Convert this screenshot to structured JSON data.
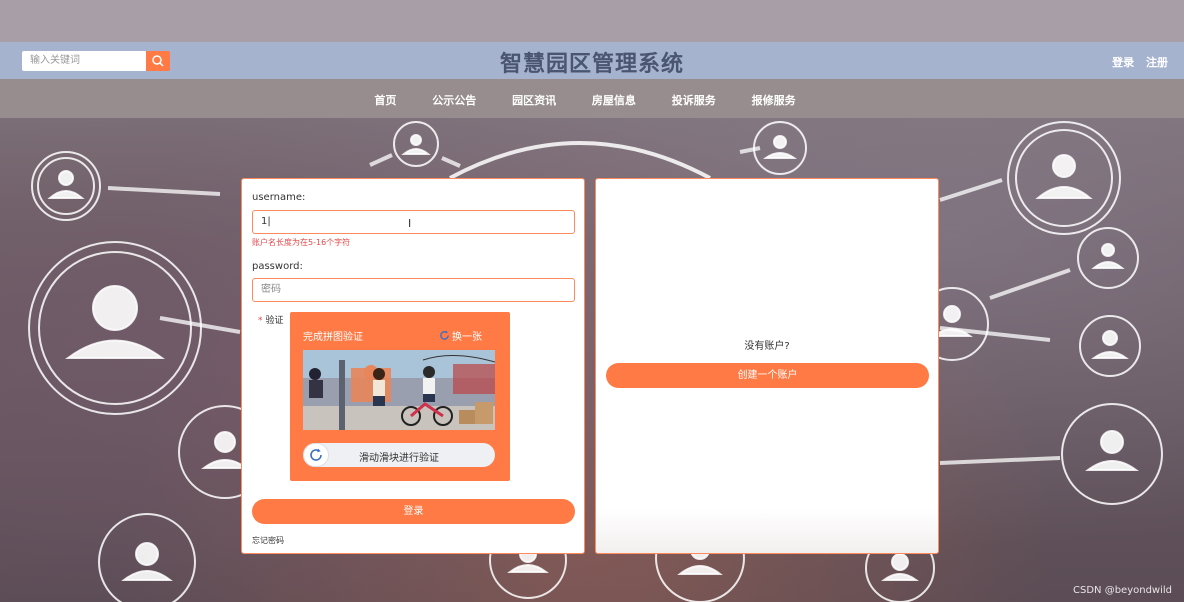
{
  "header": {
    "search_placeholder": "输入关键词",
    "site_title": "智慧园区管理系统",
    "login_link": "登录",
    "register_link": "注册"
  },
  "nav": {
    "items": [
      "首页",
      "公示公告",
      "园区资讯",
      "房屋信息",
      "投诉服务",
      "报修服务"
    ]
  },
  "login_form": {
    "username_label": "username:",
    "username_value": "1",
    "username_error": "账户名长度为在5-16个字符",
    "password_label": "password:",
    "password_placeholder": "密码",
    "verify_required_mark": "*",
    "verify_label": "验证",
    "captcha": {
      "title": "完成拼图验证",
      "refresh_label": "换一张",
      "slider_text": "滑动滑块进行验证"
    },
    "login_button": "登录",
    "forgot_password": "忘记密码"
  },
  "register_panel": {
    "no_account_text": "没有账户?",
    "create_account_button": "创建一个账户"
  },
  "watermark": "CSDN @beyondwild",
  "colors": {
    "accent": "#ff7a45",
    "header_bg": "#a6b3cf",
    "nav_bg": "#978d8e",
    "error": "#e44a4a"
  }
}
